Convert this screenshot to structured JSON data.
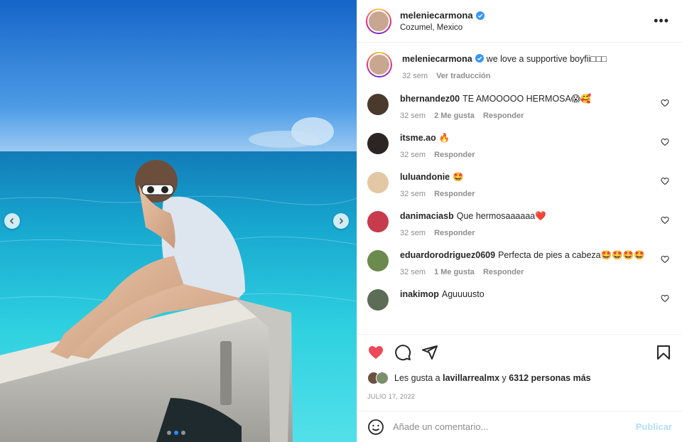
{
  "post": {
    "username": "meleniecarmona",
    "location": "Cozumel, Mexico",
    "more_label": "•••",
    "caption_user": "meleniecarmona",
    "caption_text": "we love a supportive boyfii□□□",
    "caption_time": "32 sem",
    "translate_label": "Ver traducción"
  },
  "comments": [
    {
      "user": "bhernandez00",
      "text": "TE AMOOOOO HERMOSA😱🥰",
      "time": "32 sem",
      "likes": "2 Me gusta",
      "reply": "Responder",
      "avatar_color": "#4a3a2e"
    },
    {
      "user": "itsme.ao",
      "text": "🔥",
      "time": "32 sem",
      "likes": "",
      "reply": "Responder",
      "avatar_color": "#2b2624"
    },
    {
      "user": "luluandonie",
      "text": "🤩",
      "time": "32 sem",
      "likes": "",
      "reply": "Responder",
      "avatar_color": "#e2c8a4"
    },
    {
      "user": "danimaciasb",
      "text": "Que hermosaaaaaa❤️",
      "time": "32 sem",
      "likes": "",
      "reply": "Responder",
      "avatar_color": "#c73b4c"
    },
    {
      "user": "eduardorodriguez0609",
      "text": "Perfecta de pies a cabeza🤩🤩🤩🤩",
      "time": "32 sem",
      "likes": "1 Me gusta",
      "reply": "Responder",
      "avatar_color": "#6a8a4e"
    },
    {
      "user": "inakimop",
      "text": "Aguuuusto",
      "time": "",
      "likes": "",
      "reply": "",
      "avatar_color": "#5c6c56"
    }
  ],
  "likes": {
    "prefix": "Les gusta a",
    "user": "lavillarrealmx",
    "connector": "y",
    "others": "6312 personas más"
  },
  "date": "JULIO 17, 2022",
  "add_comment": {
    "placeholder": "Añade un comentario...",
    "publish_label": "Publicar"
  },
  "colors": {
    "like_red": "#ed4956",
    "verified_blue": "#3897f0",
    "publish_disabled": "#b2dffc",
    "carousel_active": "#1e90ff"
  },
  "icons": {
    "like": "heart-filled-icon",
    "comment": "comment-bubble-icon",
    "share": "paper-plane-icon",
    "save": "bookmark-icon",
    "emoji": "smiley-icon"
  }
}
